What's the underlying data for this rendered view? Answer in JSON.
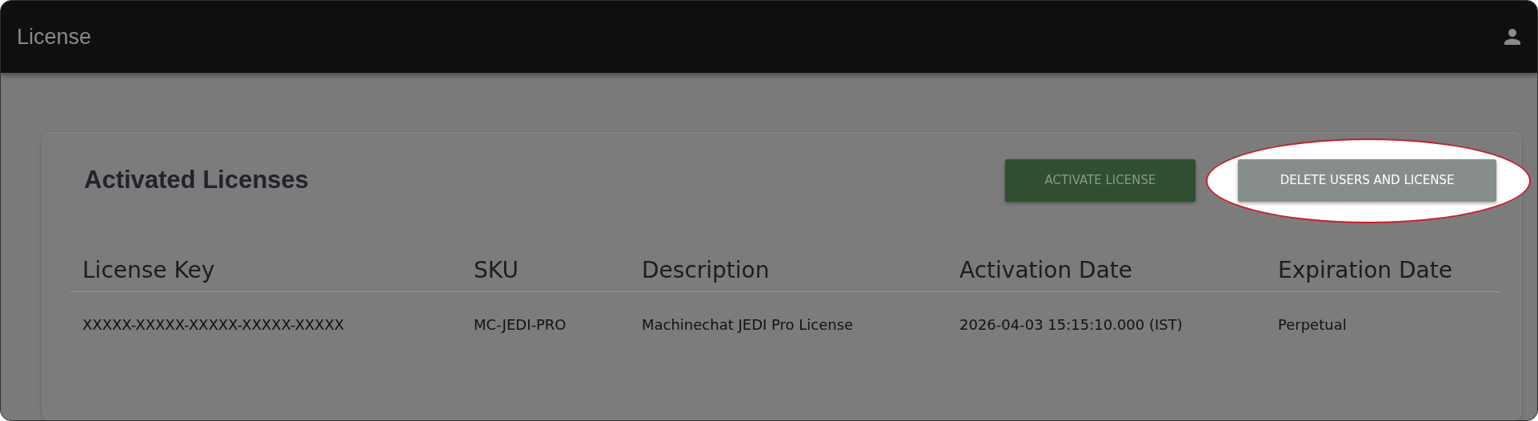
{
  "app_bar": {
    "title": "License"
  },
  "card": {
    "heading": "Activated Licenses",
    "buttons": [
      {
        "label": "ACTIVATE LICENSE",
        "kind": "primary",
        "highlighted": false
      },
      {
        "label": "DELETE USERS AND LICENSE",
        "kind": "secondary",
        "highlighted": true
      }
    ],
    "table": {
      "columns": [
        "License Key",
        "SKU",
        "Description",
        "Activation Date",
        "Expiration Date"
      ],
      "rows": [
        [
          "XXXXX-XXXXX-XXXXX-XXXXX-XXXXX",
          "MC-JEDI-PRO",
          "Machinechat JEDI Pro License",
          "2026-04-03 15:15:10.000 (IST)",
          "Perpetual"
        ]
      ]
    }
  }
}
